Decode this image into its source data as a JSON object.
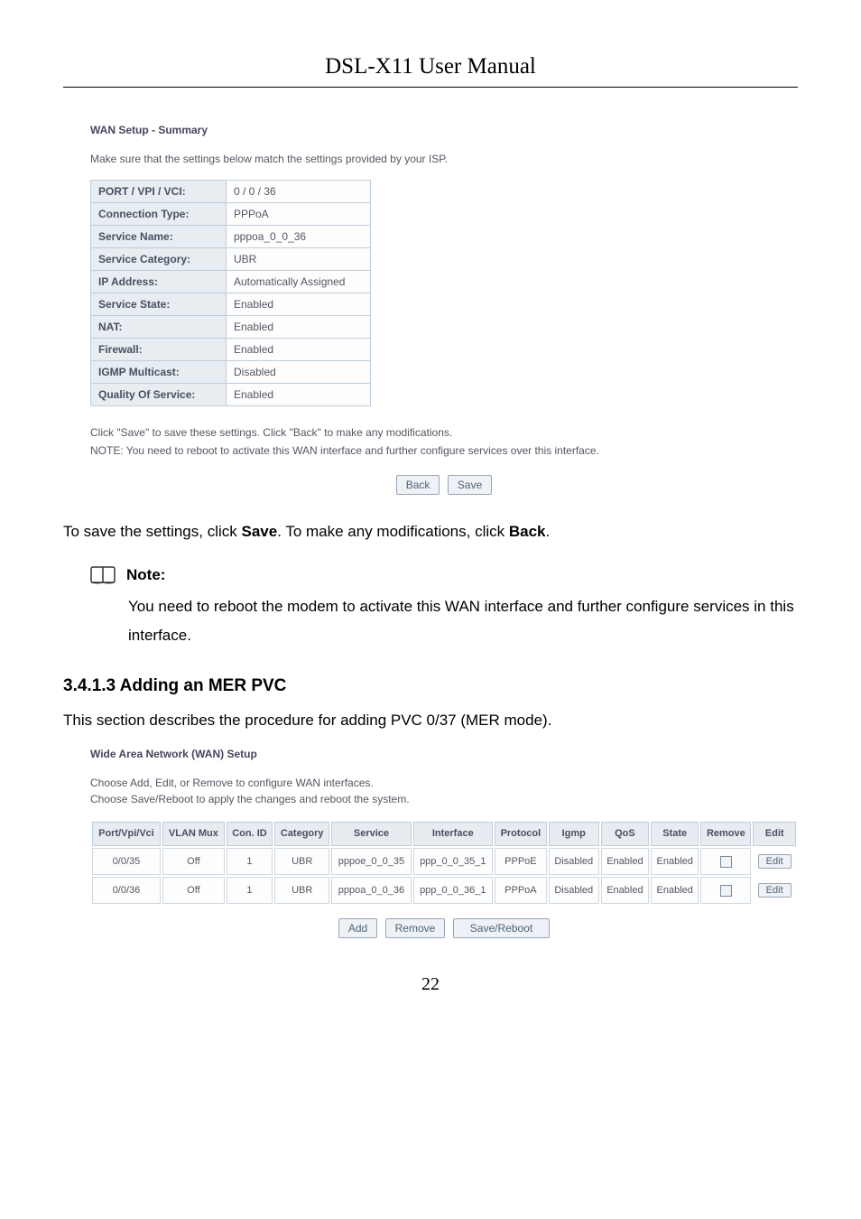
{
  "header": {
    "title": "DSL-X11 User Manual"
  },
  "wan_summary": {
    "title": "WAN Setup - Summary",
    "desc": "Make sure that the settings below match the settings provided by your ISP.",
    "rows": [
      {
        "k": "PORT / VPI / VCI:",
        "v": "0 / 0 / 36"
      },
      {
        "k": "Connection Type:",
        "v": "PPPoA"
      },
      {
        "k": "Service Name:",
        "v": "pppoa_0_0_36"
      },
      {
        "k": "Service Category:",
        "v": "UBR"
      },
      {
        "k": "IP Address:",
        "v": "Automatically Assigned"
      },
      {
        "k": "Service State:",
        "v": "Enabled"
      },
      {
        "k": "NAT:",
        "v": "Enabled"
      },
      {
        "k": "Firewall:",
        "v": "Enabled"
      },
      {
        "k": "IGMP Multicast:",
        "v": "Disabled"
      },
      {
        "k": "Quality Of Service:",
        "v": "Enabled"
      }
    ],
    "footer1": "Click \"Save\" to save these settings. Click \"Back\" to make any modifications.",
    "footer2": "NOTE: You need to reboot to activate this WAN interface and further configure services over this interface.",
    "back_btn": "Back",
    "save_btn": "Save"
  },
  "body": {
    "save_line_pre": "To save the settings, click ",
    "save_bold": "Save",
    "save_line_mid": ". To make any modifications, click ",
    "back_bold": "Back",
    "save_line_post": ".",
    "note_title": "Note:",
    "note_body": "You need to reboot the modem to activate this WAN interface and further configure services in this interface.",
    "subhead": "3.4.1.3  Adding an MER PVC",
    "subdesc": "This section describes the procedure for adding PVC 0/37 (MER mode)."
  },
  "wan_setup": {
    "title": "Wide Area Network (WAN) Setup",
    "desc1": "Choose Add, Edit, or Remove to configure WAN interfaces.",
    "desc2": "Choose Save/Reboot to apply the changes and reboot the system.",
    "headers": {
      "port": "Port/Vpi/Vci",
      "vlan": "VLAN Mux",
      "con": "Con. ID",
      "cat": "Category",
      "svc": "Service",
      "iface": "Interface",
      "proto": "Protocol",
      "igmp": "Igmp",
      "qos": "QoS",
      "state": "State",
      "remove": "Remove",
      "edit": "Edit"
    },
    "rows": [
      {
        "port": "0/0/35",
        "vlan": "Off",
        "con": "1",
        "cat": "UBR",
        "svc": "pppoe_0_0_35",
        "iface": "ppp_0_0_35_1",
        "proto": "PPPoE",
        "igmp": "Disabled",
        "qos": "Enabled",
        "state": "Enabled",
        "edit": "Edit"
      },
      {
        "port": "0/0/36",
        "vlan": "Off",
        "con": "1",
        "cat": "UBR",
        "svc": "pppoa_0_0_36",
        "iface": "ppp_0_0_36_1",
        "proto": "PPPoA",
        "igmp": "Disabled",
        "qos": "Enabled",
        "state": "Enabled",
        "edit": "Edit"
      }
    ],
    "add_btn": "Add",
    "remove_btn": "Remove",
    "savereboot_btn": "Save/Reboot"
  },
  "page_no": "22"
}
